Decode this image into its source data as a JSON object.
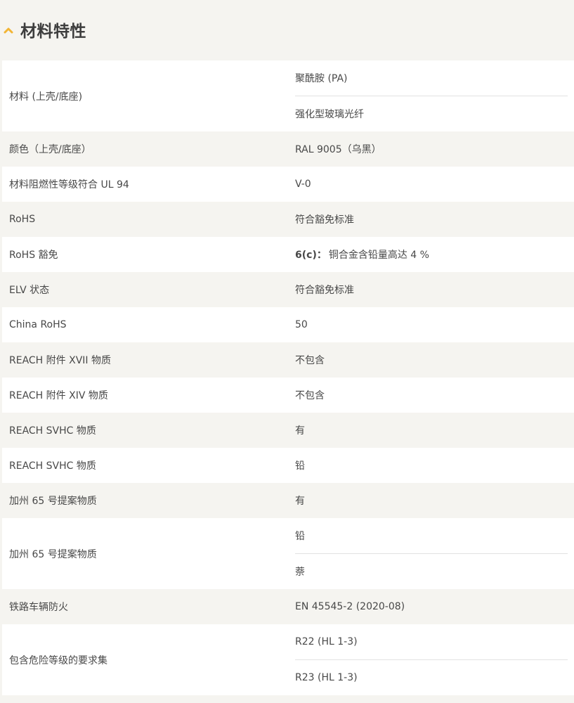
{
  "section": {
    "title": "材料特性",
    "toggle_icon": "chevron-up-icon",
    "accent_color": "#f2b535"
  },
  "rows": [
    {
      "label": "材料 (上壳/底座)",
      "values": [
        "聚酰胺 (PA)",
        "强化型玻璃光纤"
      ]
    },
    {
      "label": "颜色（上壳/底座）",
      "values": [
        "RAL 9005（乌黑）"
      ]
    },
    {
      "label": "材料阻燃性等级符合 UL 94",
      "values": [
        "V-0"
      ]
    },
    {
      "label": "RoHS",
      "values": [
        "符合豁免标准"
      ]
    },
    {
      "label": "RoHS 豁免",
      "values": [],
      "value_strong": "6(c)：",
      "value_rest": "铜合金含铅量高达 4 %"
    },
    {
      "label": "ELV 状态",
      "values": [
        "符合豁免标准"
      ]
    },
    {
      "label": "China RoHS",
      "values": [
        "50"
      ]
    },
    {
      "label": "REACH 附件 XVII 物质",
      "values": [
        "不包含"
      ]
    },
    {
      "label": "REACH 附件 XIV 物质",
      "values": [
        "不包含"
      ]
    },
    {
      "label": "REACH SVHC 物质",
      "values": [
        "有"
      ]
    },
    {
      "label": "REACH SVHC 物质",
      "values": [
        "铅"
      ]
    },
    {
      "label": "加州 65 号提案物质",
      "values": [
        "有"
      ]
    },
    {
      "label": "加州 65 号提案物质",
      "values": [
        "铅",
        "萘"
      ]
    },
    {
      "label": "铁路车辆防火",
      "values": [
        "EN 45545-2 (2020-08)"
      ]
    },
    {
      "label": "包含危险等级的要求集",
      "values": [
        "R22 (HL 1-3)",
        "R23 (HL 1-3)"
      ]
    }
  ]
}
